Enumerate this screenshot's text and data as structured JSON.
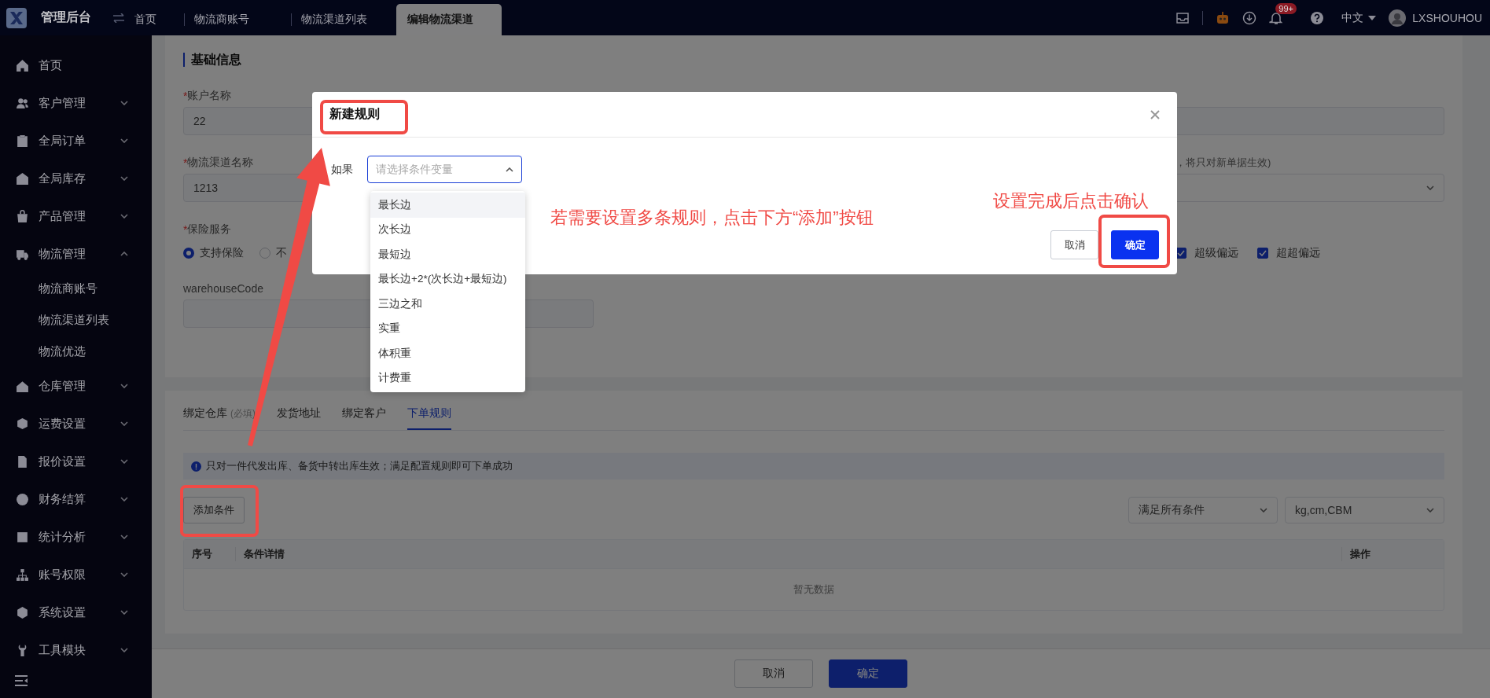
{
  "top_bar": {
    "title": "管理后台",
    "tabs": [
      {
        "label": "首页",
        "selected": false
      },
      {
        "label": "物流商账号",
        "selected": false
      },
      {
        "label": "物流渠道列表",
        "selected": false
      },
      {
        "label": "编辑物流渠道",
        "selected": true
      }
    ],
    "notification_badge": "99+",
    "language": "中文",
    "user": "LXSHOUHOU"
  },
  "sidebar": {
    "items": [
      {
        "label": "首页"
      },
      {
        "label": "客户管理",
        "expanded": false
      },
      {
        "label": "全局订单",
        "expanded": false
      },
      {
        "label": "全局库存",
        "expanded": false
      },
      {
        "label": "产品管理",
        "expanded": false
      },
      {
        "label": "物流管理",
        "expanded": true,
        "children": [
          {
            "label": "物流商账号"
          },
          {
            "label": "物流渠道列表"
          },
          {
            "label": "物流优选"
          }
        ]
      },
      {
        "label": "仓库管理",
        "expanded": false
      },
      {
        "label": "运费设置",
        "expanded": false
      },
      {
        "label": "报价设置",
        "expanded": false
      },
      {
        "label": "财务结算",
        "expanded": false
      },
      {
        "label": "统计分析",
        "expanded": false
      },
      {
        "label": "账号权限",
        "expanded": false
      },
      {
        "label": "系统设置",
        "expanded": false
      },
      {
        "label": "工具模块",
        "expanded": false
      }
    ]
  },
  "basic_info": {
    "title": "基础信息",
    "account_name": {
      "mark": "*",
      "label": "账户名称",
      "value": "22"
    },
    "channel_name": {
      "mark": "*",
      "label": "物流渠道名称",
      "value": "1213"
    },
    "channel_hint": "，将只对新单据生效)",
    "insurance": {
      "mark": "*",
      "label": "保险服务",
      "options": [
        {
          "label": "支持保险",
          "selected": true
        },
        {
          "label": "不",
          "selected": false
        }
      ]
    },
    "remote_options": [
      {
        "label": "超级偏远",
        "checked": true
      },
      {
        "label": "超超偏远",
        "checked": true
      }
    ],
    "warehouse_code": {
      "label": "warehouseCode"
    }
  },
  "rules_panel": {
    "tabs": [
      {
        "label": "绑定仓库",
        "note": "(必填)",
        "selected": false
      },
      {
        "label": "发货地址",
        "selected": false
      },
      {
        "label": "绑定客户",
        "selected": false
      },
      {
        "label": "下单规则",
        "selected": true
      }
    ],
    "notice": "只对一件代发出库、备货中转出库生效；满足配置规则即可下单成功",
    "add_button": "添加条件",
    "match_select": "满足所有条件",
    "unit_select": "kg,cm,CBM",
    "table": {
      "columns": [
        "序号",
        "条件详情",
        "操作"
      ],
      "empty_text": "暂无数据"
    }
  },
  "footer": {
    "buttons": [
      {
        "label": "取消",
        "kind": "default"
      },
      {
        "label": "确定",
        "kind": "primary"
      }
    ]
  },
  "modal": {
    "title": "新建规则",
    "condition_label": "如果",
    "select_placeholder": "请选择条件变量",
    "options": [
      {
        "label": "最长边",
        "selected": true
      },
      {
        "label": "次长边",
        "selected": false
      },
      {
        "label": "最短边",
        "selected": false
      },
      {
        "label": "最长边+2*(次长边+最短边)",
        "selected": false
      },
      {
        "label": "三边之和",
        "selected": false
      },
      {
        "label": "实重",
        "selected": false
      },
      {
        "label": "体积重",
        "selected": false
      },
      {
        "label": "计费重",
        "selected": false
      }
    ],
    "buttons": [
      {
        "label": "取消",
        "kind": "default"
      },
      {
        "label": "确定",
        "kind": "primary"
      }
    ]
  },
  "annotations": {
    "notes": [
      "若需要设置多条规则，点击下方“添加”按钮",
      "设置完成后点击确认"
    ]
  }
}
